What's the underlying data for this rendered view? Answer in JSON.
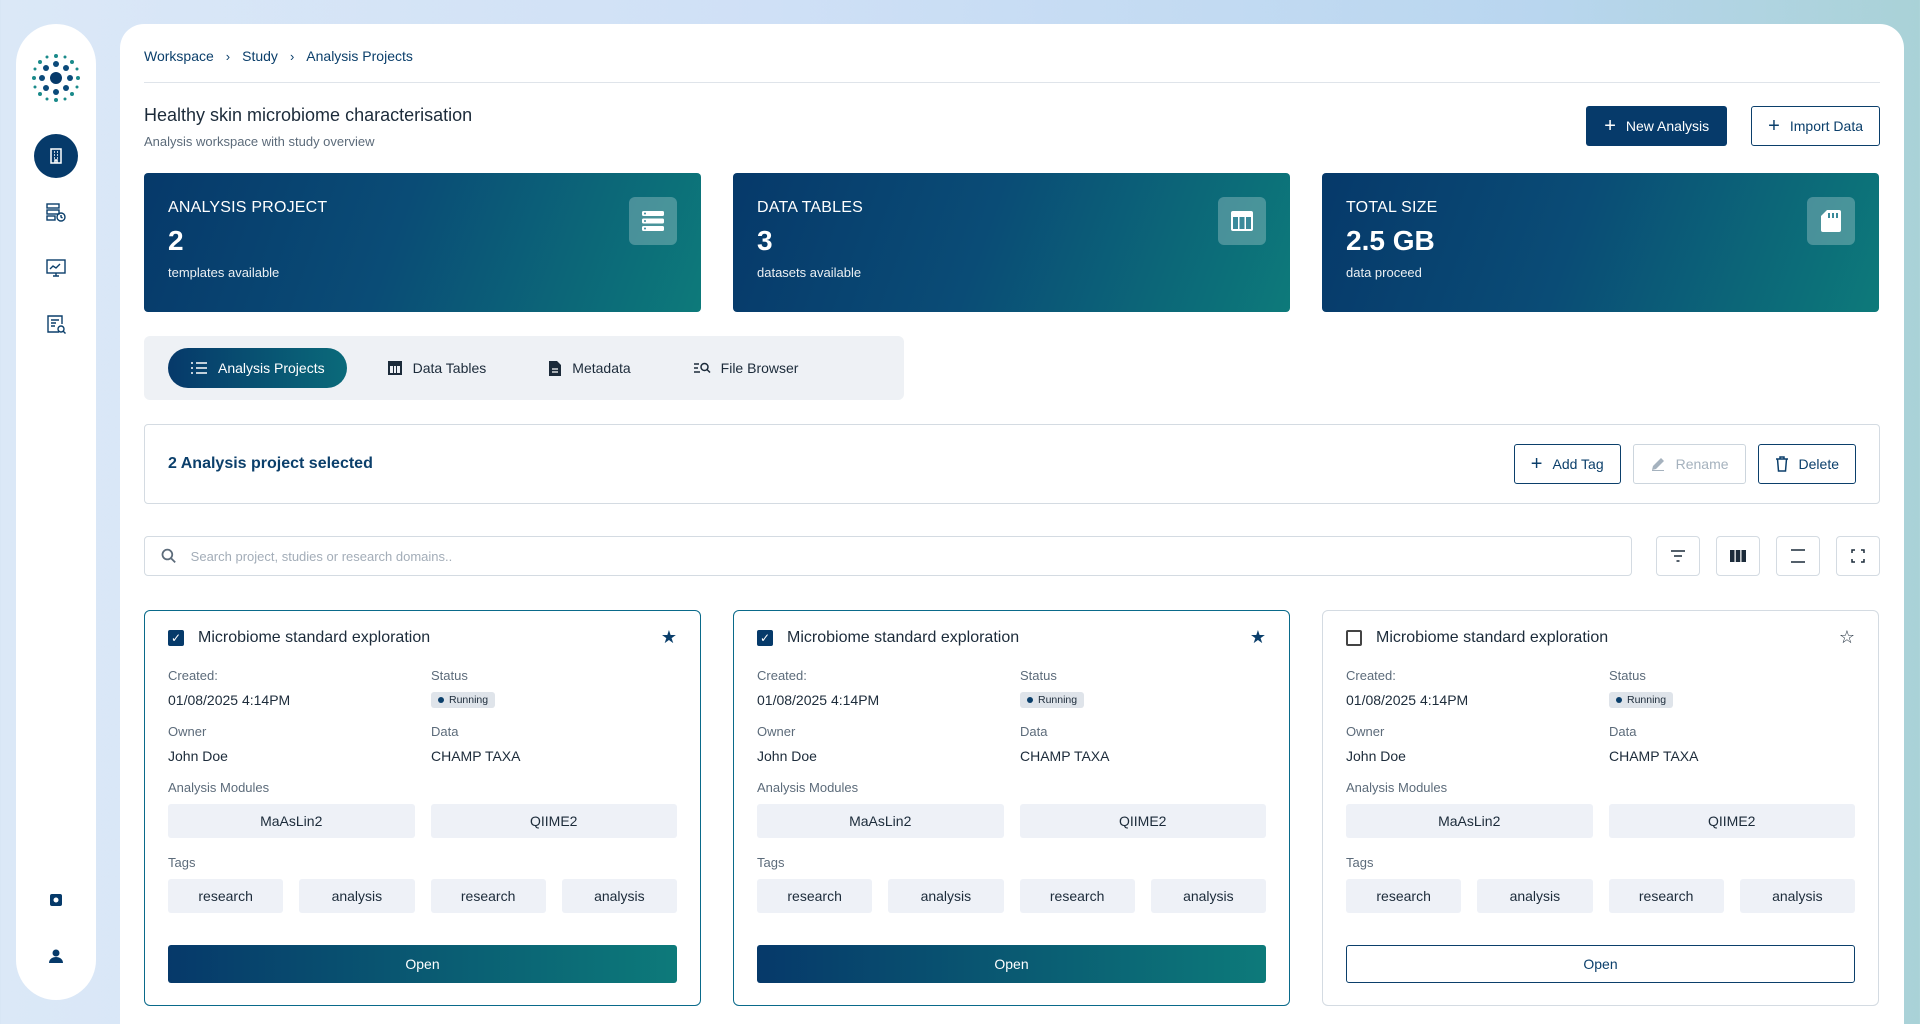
{
  "breadcrumb": [
    "Workspace",
    "Study",
    "Analysis Projects"
  ],
  "header": {
    "title": "Healthy skin microbiome characterisation",
    "subtitle": "Analysis workspace with study overview",
    "new_analysis": "New Analysis",
    "import_data": "Import Data"
  },
  "stats": [
    {
      "label": "ANALYSIS PROJECT",
      "value": "2",
      "sub": "templates available",
      "icon": "list-icon"
    },
    {
      "label": "DATA TABLES",
      "value": "3",
      "sub": "datasets available",
      "icon": "table-icon"
    },
    {
      "label": "TOTAL SIZE",
      "value": "2.5 GB",
      "sub": "data proceed",
      "icon": "sd-card-icon"
    }
  ],
  "tabs": [
    {
      "label": "Analysis Projects",
      "icon": "list-icon",
      "active": true
    },
    {
      "label": "Data Tables",
      "icon": "table-icon"
    },
    {
      "label": "Metadata",
      "icon": "document-icon"
    },
    {
      "label": "File Browser",
      "icon": "file-search-icon"
    }
  ],
  "selection": {
    "text": "2 Analysis project selected",
    "add_tag": "Add Tag",
    "rename": "Rename",
    "delete": "Delete"
  },
  "search": {
    "placeholder": "Search project, studies or research domains.."
  },
  "labels": {
    "created": "Created:",
    "status": "Status",
    "owner": "Owner",
    "data": "Data",
    "modules": "Analysis Modules",
    "tags": "Tags",
    "open": "Open"
  },
  "cards": [
    {
      "title": "Microbiome standard exploration",
      "checked": true,
      "starred": true,
      "created": "01/08/2025 4:14PM",
      "status": "Running",
      "owner": "John Doe",
      "data": "CHAMP TAXA",
      "modules": [
        "MaAsLin2",
        "QIIME2"
      ],
      "tags": [
        "research",
        "analysis",
        "research",
        "analysis"
      ]
    },
    {
      "title": "Microbiome standard exploration",
      "checked": true,
      "starred": true,
      "created": "01/08/2025 4:14PM",
      "status": "Running",
      "owner": "John Doe",
      "data": "CHAMP TAXA",
      "modules": [
        "MaAsLin2",
        "QIIME2"
      ],
      "tags": [
        "research",
        "analysis",
        "research",
        "analysis"
      ]
    },
    {
      "title": "Microbiome standard exploration",
      "checked": false,
      "starred": false,
      "created": "01/08/2025 4:14PM",
      "status": "Running",
      "owner": "John Doe",
      "data": "CHAMP TAXA",
      "modules": [
        "MaAsLin2",
        "QIIME2"
      ],
      "tags": [
        "research",
        "analysis",
        "research",
        "analysis"
      ]
    }
  ],
  "colors": {
    "primary": "#063a6a",
    "teal": "#0d7a7a"
  }
}
